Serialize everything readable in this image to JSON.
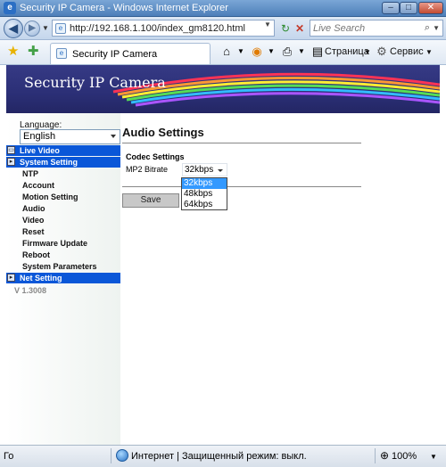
{
  "window": {
    "title": "Security IP Camera - Windows Internet Explorer"
  },
  "address": {
    "url": "http://192.168.1.100/index_gm8120.html",
    "search_placeholder": "Live Search"
  },
  "toolbar": {
    "tab_title": "Security IP Camera",
    "page_menu": "Страница",
    "tools_menu": "Сервис"
  },
  "banner": {
    "title": "Security IP Camera"
  },
  "sidebar": {
    "language_label": "Language:",
    "language_value": "English",
    "menu": [
      {
        "label": "Live Video",
        "type": "head"
      },
      {
        "label": "System Setting",
        "type": "head"
      },
      {
        "label": "NTP",
        "type": "sub"
      },
      {
        "label": "Account",
        "type": "sub"
      },
      {
        "label": "Motion Setting",
        "type": "sub"
      },
      {
        "label": "Audio",
        "type": "sub"
      },
      {
        "label": "Video",
        "type": "sub"
      },
      {
        "label": "Reset",
        "type": "sub"
      },
      {
        "label": "Firmware Update",
        "type": "sub"
      },
      {
        "label": "Reboot",
        "type": "sub"
      },
      {
        "label": "System Parameters",
        "type": "sub"
      },
      {
        "label": "Net Setting",
        "type": "head"
      }
    ],
    "version": "V 1.3008"
  },
  "main": {
    "heading": "Audio Settings",
    "section_title": "Codec Settings",
    "field_label": "MP2 Bitrate",
    "bitrate_value": "32kbps",
    "bitrate_options": [
      "32kbps",
      "48kbps",
      "64kbps"
    ],
    "save_label": "Save"
  },
  "status": {
    "left_text": "Го",
    "zone_text": "Интернет | Защищенный режим: выкл.",
    "zoom": "100%"
  },
  "colors": {
    "menu_head": "#0a57d8",
    "banner": "#2b2f76",
    "dropdown_selected": "#3399ff"
  }
}
